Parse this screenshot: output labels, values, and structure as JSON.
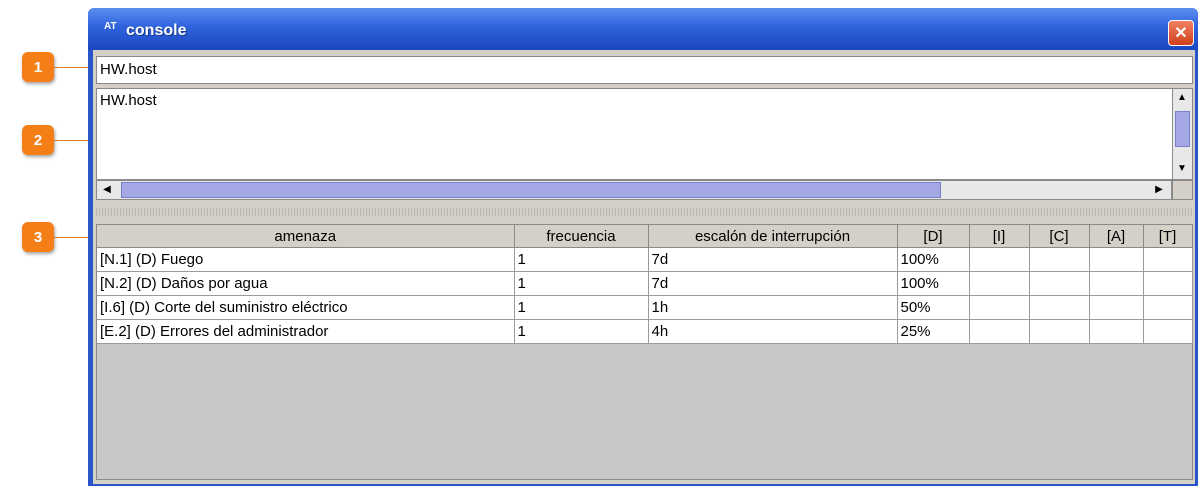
{
  "callouts": [
    "1",
    "2",
    "3"
  ],
  "window": {
    "icon": "AT",
    "title": "console",
    "close_glyph": "✕"
  },
  "command": {
    "value": "HW.host"
  },
  "output": {
    "text": "HW.host"
  },
  "table": {
    "headers": [
      "amenaza",
      "frecuencia",
      "escalón de interrupción",
      "[D]",
      "[I]",
      "[C]",
      "[A]",
      "[T]"
    ],
    "rows": [
      [
        "[N.1] (D) Fuego",
        "1",
        "7d",
        "100%",
        "",
        "",
        "",
        ""
      ],
      [
        "[N.2] (D) Daños por agua",
        "1",
        "7d",
        "100%",
        "",
        "",
        "",
        ""
      ],
      [
        "[I.6] (D) Corte del suministro eléctrico",
        "1",
        "1h",
        "50%",
        "",
        "",
        "",
        ""
      ],
      [
        "[E.2] (D) Errores del administrador",
        "1",
        "4h",
        "25%",
        "",
        "",
        "",
        ""
      ]
    ]
  },
  "colors": {
    "callout": "#f57f17",
    "titlebar": "#2f62dc",
    "scroll_thumb": "#a4a8e4"
  }
}
